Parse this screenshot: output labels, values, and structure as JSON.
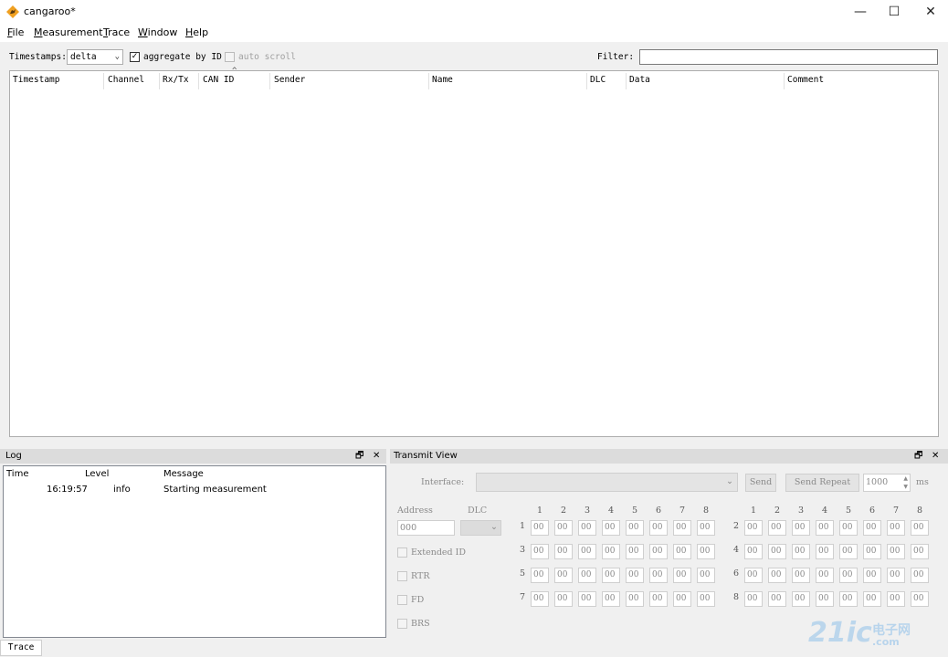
{
  "window": {
    "title": "cangaroo*",
    "minimize": "—",
    "maximize": "☐",
    "close": "✕"
  },
  "menu": {
    "file": {
      "u": "F",
      "rest": "ile"
    },
    "measurement": {
      "u": "M",
      "rest": "easurement"
    },
    "trace": {
      "u": "T",
      "rest": "race"
    },
    "window": {
      "u": "W",
      "rest": "indow"
    },
    "help": {
      "u": "H",
      "rest": "elp"
    }
  },
  "toolbar": {
    "timestamps_label": "Timestamps:",
    "timestamps_value": "delta",
    "aggregate_label": "aggregate by ID",
    "aggregate_checked": "✓",
    "autoscroll_label": "auto scroll",
    "filter_label": "Filter:",
    "filter_value": ""
  },
  "trace": {
    "sort_indicator": "^",
    "columns": [
      "Timestamp",
      "Channel",
      "Rx/Tx",
      "CAN ID",
      "Sender",
      "Name",
      "DLC",
      "Data",
      "Comment"
    ]
  },
  "log": {
    "title": "Log",
    "float_icon": "🗗",
    "close_icon": "✕",
    "columns": [
      "Time",
      "Level",
      "Message"
    ],
    "rows": [
      {
        "time": "16:19:57",
        "level": "info",
        "message": "Starting measurement"
      }
    ]
  },
  "transmit": {
    "title": "Transmit View",
    "interface_label": "Interface:",
    "interface_value": "",
    "send_label": "Send",
    "send_repeat_label": "Send Repeat",
    "interval_value": "1000",
    "interval_unit": "ms",
    "address_label": "Address",
    "dlc_label": "DLC",
    "address_value": "000",
    "byte_cols": [
      "1",
      "2",
      "3",
      "4",
      "5",
      "6",
      "7",
      "8"
    ],
    "row_labels": [
      "1",
      "2",
      "3",
      "4",
      "5",
      "6",
      "7",
      "8"
    ],
    "byte_value": "00",
    "extended_id_label": "Extended ID",
    "rtr_label": "RTR",
    "fd_label": "FD",
    "brs_label": "BRS"
  },
  "status_tab": "Trace",
  "watermark": {
    "big": "21ic",
    "cn": "电子网",
    "en": ".com"
  }
}
